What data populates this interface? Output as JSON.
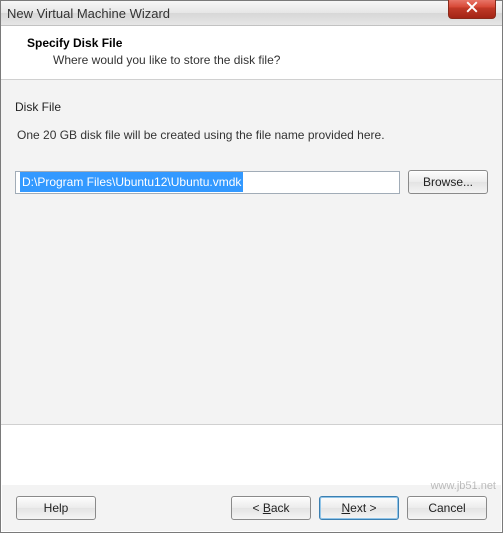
{
  "window": {
    "title": "New Virtual Machine Wizard"
  },
  "header": {
    "title": "Specify Disk File",
    "subtitle": "Where would you like to store the disk file?"
  },
  "body": {
    "group_label": "Disk File",
    "description": "One 20 GB disk file will be created using the file name provided here.",
    "path_value": "D:\\Program Files\\Ubuntu12\\Ubuntu.vmdk",
    "browse_label": "Browse..."
  },
  "footer": {
    "help_label": "Help",
    "back_label_pre": "< ",
    "back_mn": "B",
    "back_label_post": "ack",
    "next_mn": "N",
    "next_label_post": "ext >",
    "cancel_label": "Cancel"
  },
  "watermark": "www.jb51.net"
}
